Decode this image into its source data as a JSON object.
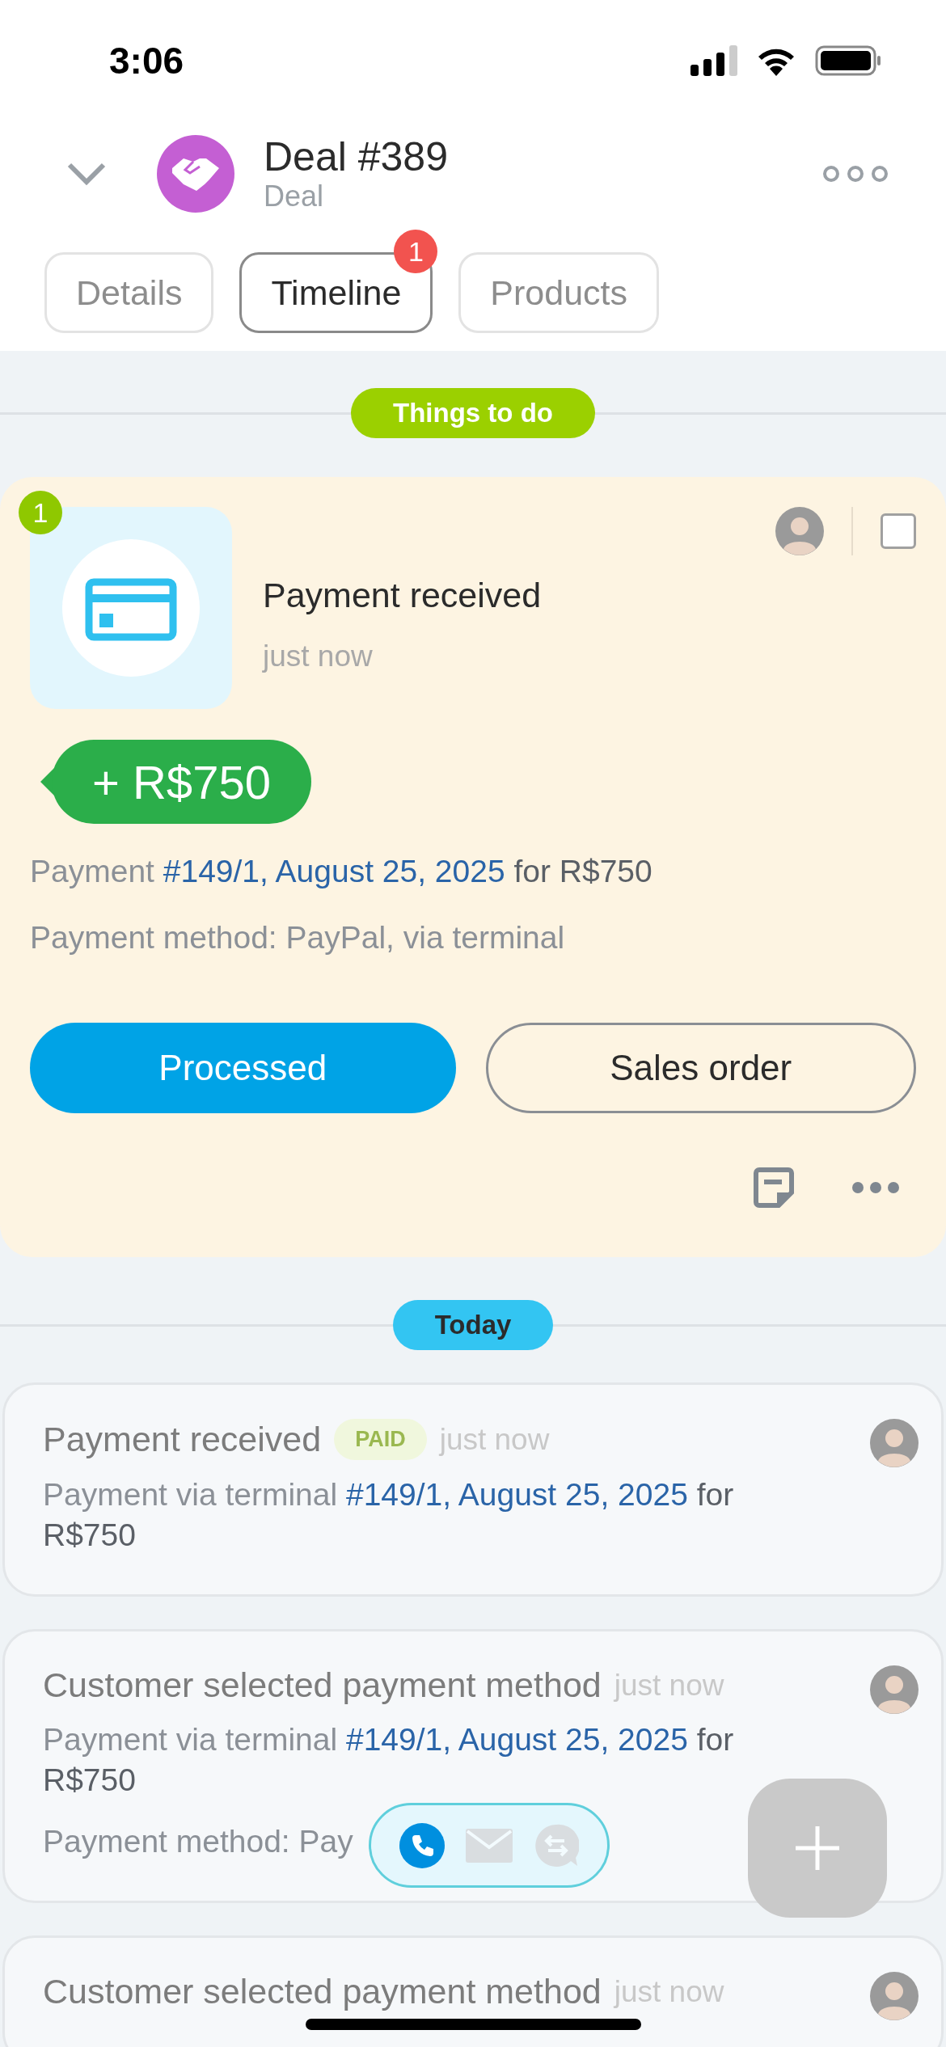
{
  "status_bar": {
    "time": "3:06"
  },
  "header": {
    "title": "Deal #389",
    "subtitle": "Deal"
  },
  "tabs": [
    {
      "label": "Details",
      "selected": false
    },
    {
      "label": "Timeline",
      "selected": true,
      "badge": "1"
    },
    {
      "label": "Products",
      "selected": false
    }
  ],
  "todo": {
    "label": "Things to do",
    "card": {
      "count": "1",
      "title": "Payment received",
      "time": "just now",
      "checked": false,
      "amount": "+ R$750",
      "lines": [
        {
          "prefix": "Payment",
          "link": "#149/1, August 25, 2025",
          "suffix": "for R$750"
        },
        {
          "prefix": "Payment method: PayPal, via terminal"
        }
      ],
      "buttons": [
        {
          "label": "Processed",
          "kind": "primary"
        },
        {
          "label": "Sales order",
          "kind": "outline"
        }
      ]
    }
  },
  "today": {
    "label": "Today",
    "items": [
      {
        "title": "Payment received",
        "tag": "PAID",
        "time": "just now",
        "lines": [
          {
            "prefix": "Payment via terminal",
            "link": "#149/1, August 25, 2025",
            "suffix": "for R$750"
          }
        ]
      },
      {
        "title": "Customer selected payment method",
        "time": "just now",
        "lines": [
          {
            "prefix": "Payment via terminal",
            "link": "#149/1, August 25, 2025",
            "suffix": "for R$750"
          },
          {
            "prefix": "Payment method: Pay"
          }
        ]
      },
      {
        "title": "Customer selected payment method",
        "time": "just now"
      }
    ]
  }
}
